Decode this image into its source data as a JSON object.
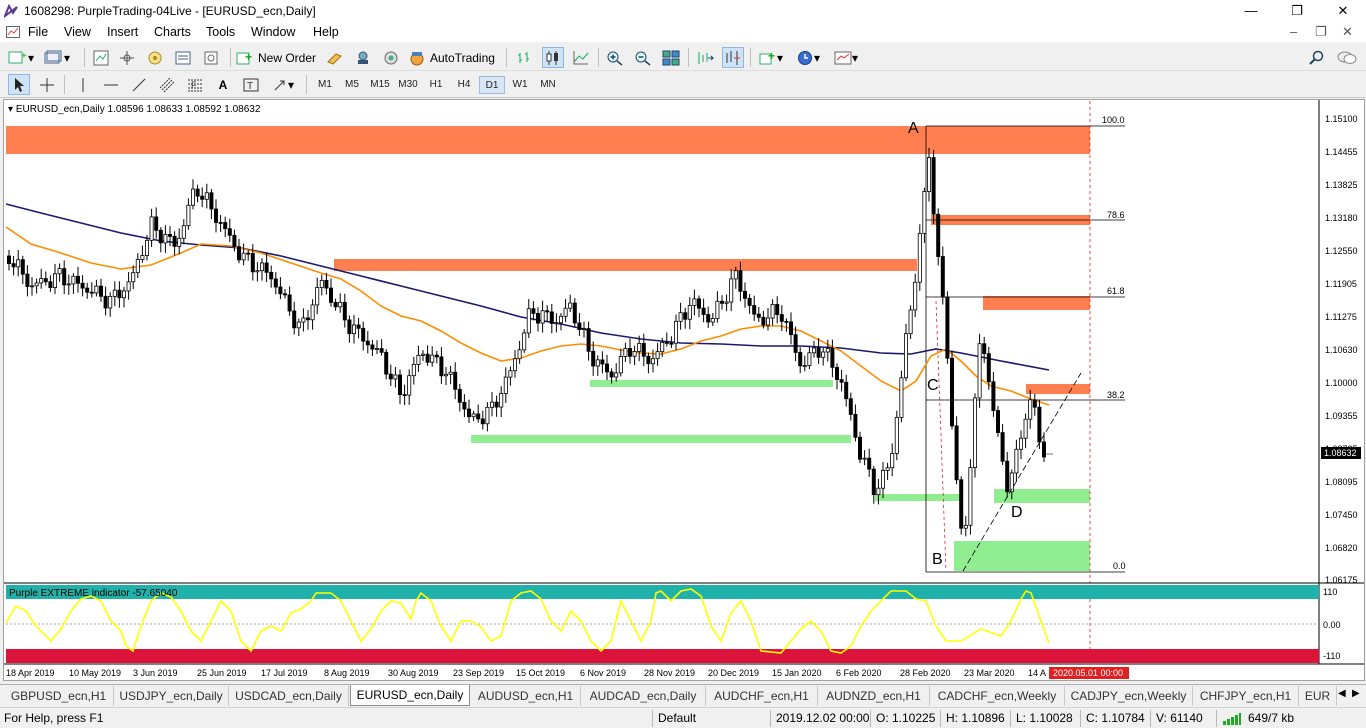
{
  "window": {
    "title": "1608298: PurpleTrading-04Live - [EURUSD_ecn,Daily]",
    "controls": [
      "—",
      "❐",
      "✕"
    ]
  },
  "menu": [
    "File",
    "View",
    "Insert",
    "Charts",
    "Tools",
    "Window",
    "Help"
  ],
  "toolbar": {
    "new_order": "New Order",
    "auto_trading": "AutoTrading"
  },
  "timeframes": [
    "M1",
    "M5",
    "M15",
    "M30",
    "H1",
    "H4",
    "D1",
    "W1",
    "MN"
  ],
  "active_timeframe": "D1",
  "chart": {
    "symbol_info": "EURUSD_ecn,Daily  1.08596 1.08633 1.08592 1.08632",
    "current_price": "1.08632",
    "price_ticks": [
      "1.15100",
      "1.14455",
      "1.13825",
      "1.13180",
      "1.12550",
      "1.11905",
      "1.11275",
      "1.10630",
      "1.10000",
      "1.09355",
      "1.08725",
      "1.08095",
      "1.07450",
      "1.06820",
      "1.06175"
    ],
    "date_ticks": [
      "18 Apr 2019",
      "10 May 2019",
      "3 Jun 2019",
      "25 Jun 2019",
      "17 Jul 2019",
      "8 Aug 2019",
      "30 Aug 2019",
      "23 Sep 2019",
      "15 Oct 2019",
      "6 Nov 2019",
      "28 Nov 2019",
      "20 Dec 2019",
      "15 Jan 2020",
      "6 Feb 2020",
      "28 Feb 2020",
      "23 Mar 2020",
      "14 A"
    ],
    "cursor_date": "2020.05.01 00:00",
    "fib_levels": [
      "100.0",
      "78.6",
      "61.8",
      "38.2",
      "0.0"
    ],
    "pattern_labels": [
      "A",
      "B",
      "C",
      "D"
    ],
    "colors": {
      "resistance": "#ff7f50",
      "support": "#90ee90",
      "ma_slow": "#191970",
      "ma_fast": "#ff8c00",
      "indicator_line": "#ffff00",
      "indicator_top": "#20b2aa",
      "indicator_bottom": "#dc143c"
    }
  },
  "indicator": {
    "label": "Purple EXTREME indicator -57.65040",
    "levels": [
      "110",
      "0.00",
      "-110"
    ]
  },
  "tabs": [
    "GBPUSD_ecn,H1",
    "USDJPY_ecn,Daily",
    "USDCAD_ecn,Daily",
    "EURUSD_ecn,Daily",
    "AUDUSD_ecn,H1",
    "AUDCAD_ecn,Daily",
    "AUDCHF_ecn,H1",
    "AUDNZD_ecn,H1",
    "CADCHF_ecn,Weekly",
    "CADJPY_ecn,Weekly",
    "CHFJPY_ecn,H1",
    "EUR"
  ],
  "active_tab": "EURUSD_ecn,Daily",
  "status": {
    "help": "For Help, press F1",
    "profile": "Default",
    "datetime": "2019.12.02 00:00",
    "open": "O: 1.10225",
    "high": "H: 1.10896",
    "low": "L: 1.10028",
    "close": "C: 1.10784",
    "volume": "V: 61140",
    "traffic": "649/7 kb"
  }
}
